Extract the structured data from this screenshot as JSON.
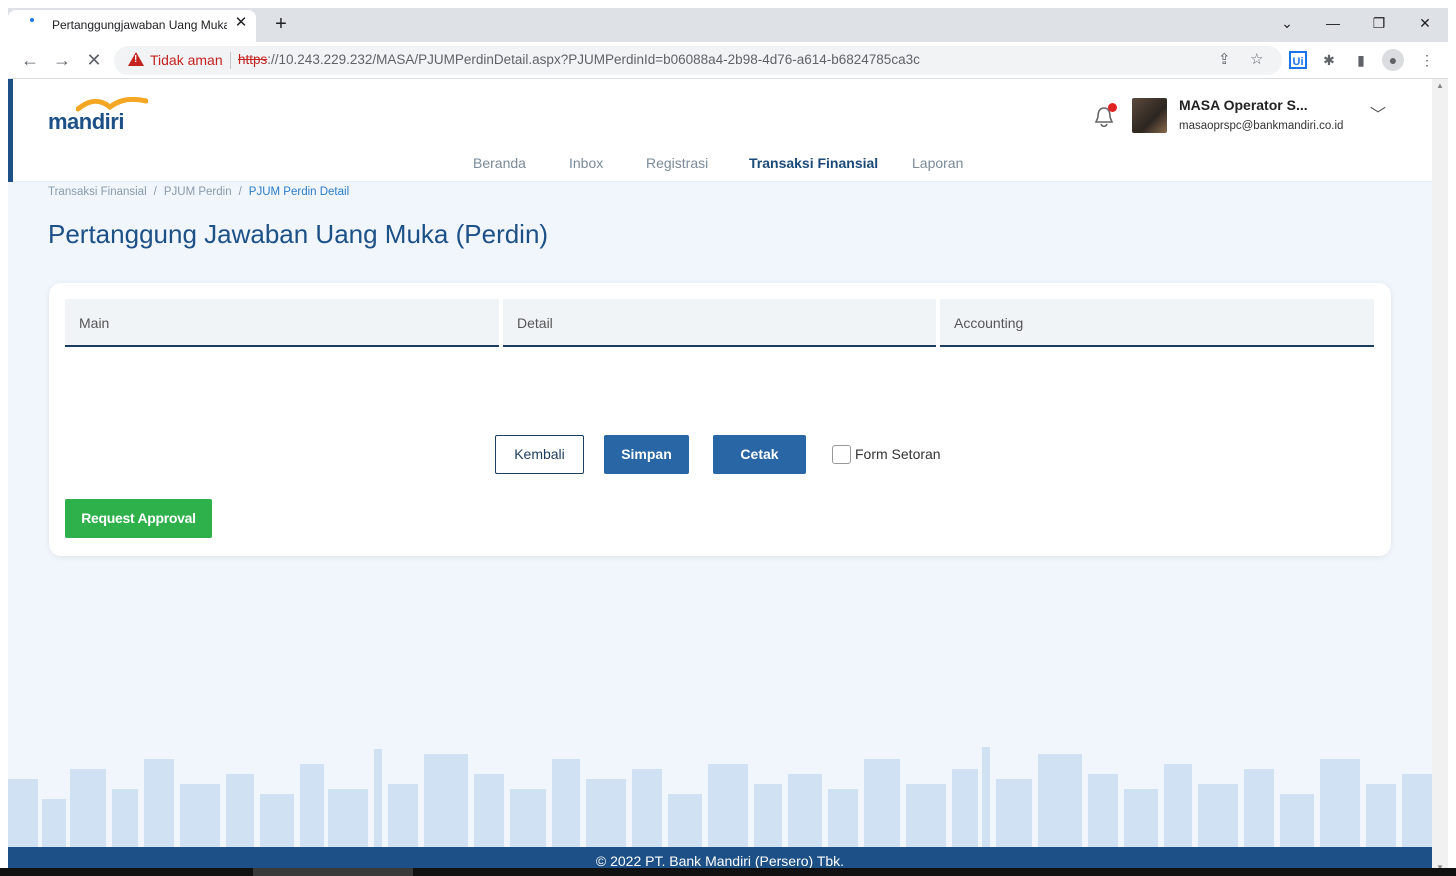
{
  "browser": {
    "tab_title": "Pertanggungjawaban Uang Muka",
    "new_tab": "+",
    "security_label": "Tidak aman",
    "url_scheme": "https",
    "url_rest": "://10.243.229.232/MASA/PJUMPerdinDetail.aspx?PJUMPerdinId=b06088a4-2b98-4d76-a614-b6824785ca3c",
    "ext_ui": "Ui"
  },
  "header": {
    "logo_text": "mandiri",
    "user_name": "MASA Operator S...",
    "user_email": "masaoprspc@bankmandiri.co.id",
    "brand_color": "#1c5086",
    "notification_color": "#e02424"
  },
  "nav": {
    "items": [
      {
        "label": "Beranda"
      },
      {
        "label": "Inbox"
      },
      {
        "label": "Registrasi"
      },
      {
        "label": "Transaksi Finansial"
      },
      {
        "label": "Laporan"
      }
    ],
    "active": "Transaksi Finansial"
  },
  "breadcrumb": [
    "Transaksi Finansial",
    "PJUM Perdin",
    "PJUM Perdin Detail"
  ],
  "page_title": "Pertanggung Jawaban Uang Muka (Perdin)",
  "tabs": [
    {
      "label": "Main"
    },
    {
      "label": "Detail"
    },
    {
      "label": "Accounting"
    }
  ],
  "actions": {
    "back": "Kembali",
    "save": "Simpan",
    "print": "Cetak",
    "form_setoran": "Form Setoran",
    "form_setoran_checked": false,
    "request_approval": "Request Approval"
  },
  "footer": "© 2022 PT. Bank Mandiri (Persero) Tbk."
}
